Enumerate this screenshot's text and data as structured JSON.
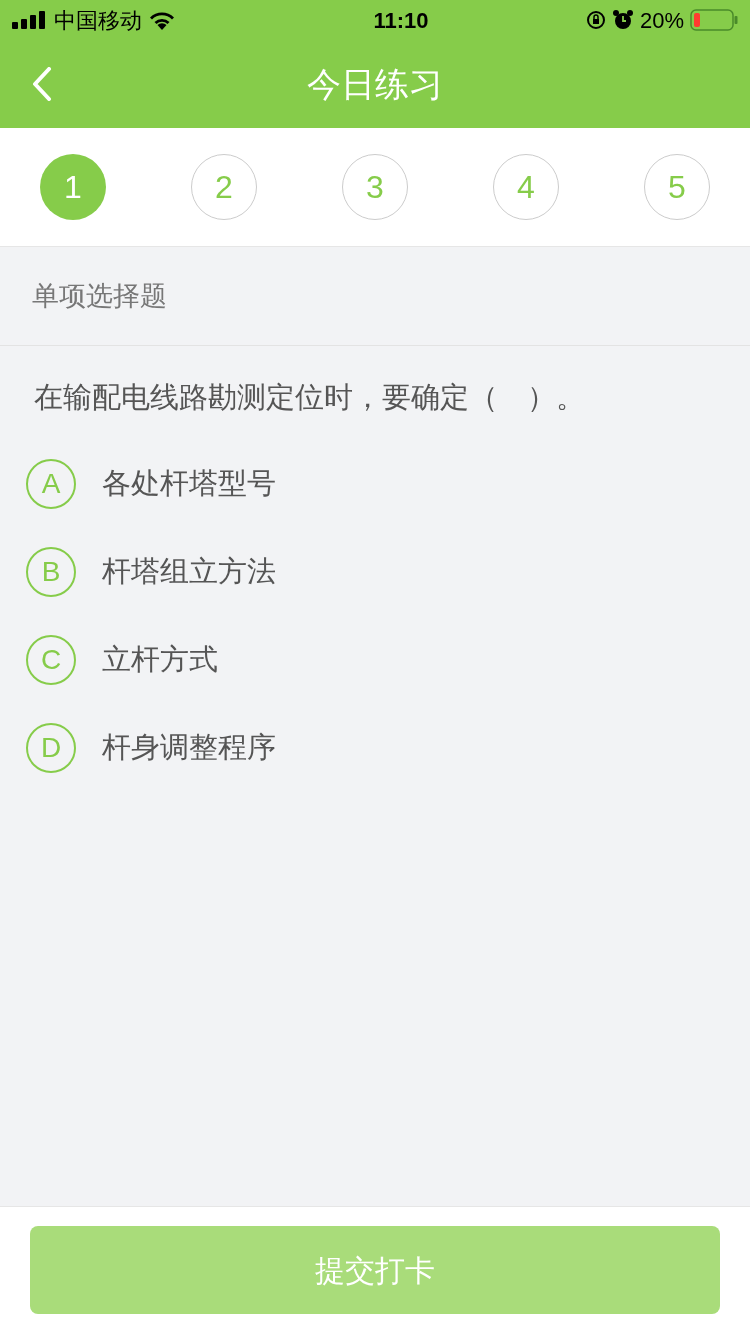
{
  "status_bar": {
    "carrier": "中国移动",
    "time": "11:10",
    "battery": "20%"
  },
  "nav": {
    "title": "今日练习"
  },
  "steps": [
    {
      "label": "1",
      "selected": true
    },
    {
      "label": "2",
      "selected": false
    },
    {
      "label": "3",
      "selected": false
    },
    {
      "label": "4",
      "selected": false
    },
    {
      "label": "5",
      "selected": false
    }
  ],
  "question_type": "单项选择题",
  "question": "在输配电线路勘测定位时，要确定（　）。",
  "options": [
    {
      "letter": "A",
      "text": "各处杆塔型号",
      "selected": false
    },
    {
      "letter": "B",
      "text": "杆塔组立方法",
      "selected": false
    },
    {
      "letter": "C",
      "text": "立杆方式",
      "selected": false
    },
    {
      "letter": "D",
      "text": "杆身调整程序",
      "selected": false
    }
  ],
  "submit": {
    "label": "提交打卡",
    "disabled": true
  }
}
